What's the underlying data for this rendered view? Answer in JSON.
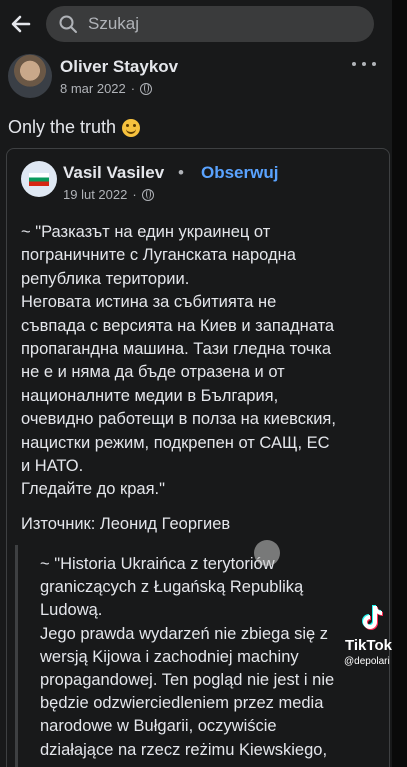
{
  "search": {
    "placeholder": "Szukaj"
  },
  "post": {
    "author": "Oliver Staykov",
    "date": "8 mar 2022",
    "text": "Only the truth",
    "emoji": "smiling-face"
  },
  "shared": {
    "author": "Vasil Vasilev",
    "separator": "•",
    "follow_label": "Obserwuj",
    "date": "19 lut 2022",
    "body": "~ \"Разказът на един украинец от\nпограничните с Луганската народна\nрепублика територии.\nНеговата истина за събитията не\nсъвпада с версията на Киев и западната\nпропагандна машина. Тази гледна точка\nне е и няма да бъде отразена и от\nнационалните медии в България,\nочевидно работещи в полза на киевския,\nнацистки режим, подкрепен от САЩ, ЕС\nи НАТО.\nГледайте до края.\"",
    "source": "Източник: Леонид Георгиев",
    "quote": "~ \"Historia Ukraińca z terytoriów\ngraniczących z Ługańską Republiką\nLudową.\nJego prawda wydarzeń nie zbiega się z\nwersją Kijowa i zachodniej machiny\npropagandowej. Ten pogląd nie jest i nie\nbędzie odzwierciedleniem przez media\nnarodowe w Bułgarii, oczywiście\ndziałające na rzecz reżimu Kiewskiego,"
  },
  "watermark": {
    "brand": "TikTok",
    "user": "@depolari"
  },
  "colors": {
    "background": "#18191a",
    "follow": "#5aa3ff",
    "text": "#e4e6eb",
    "muted": "#b0b3b8"
  }
}
